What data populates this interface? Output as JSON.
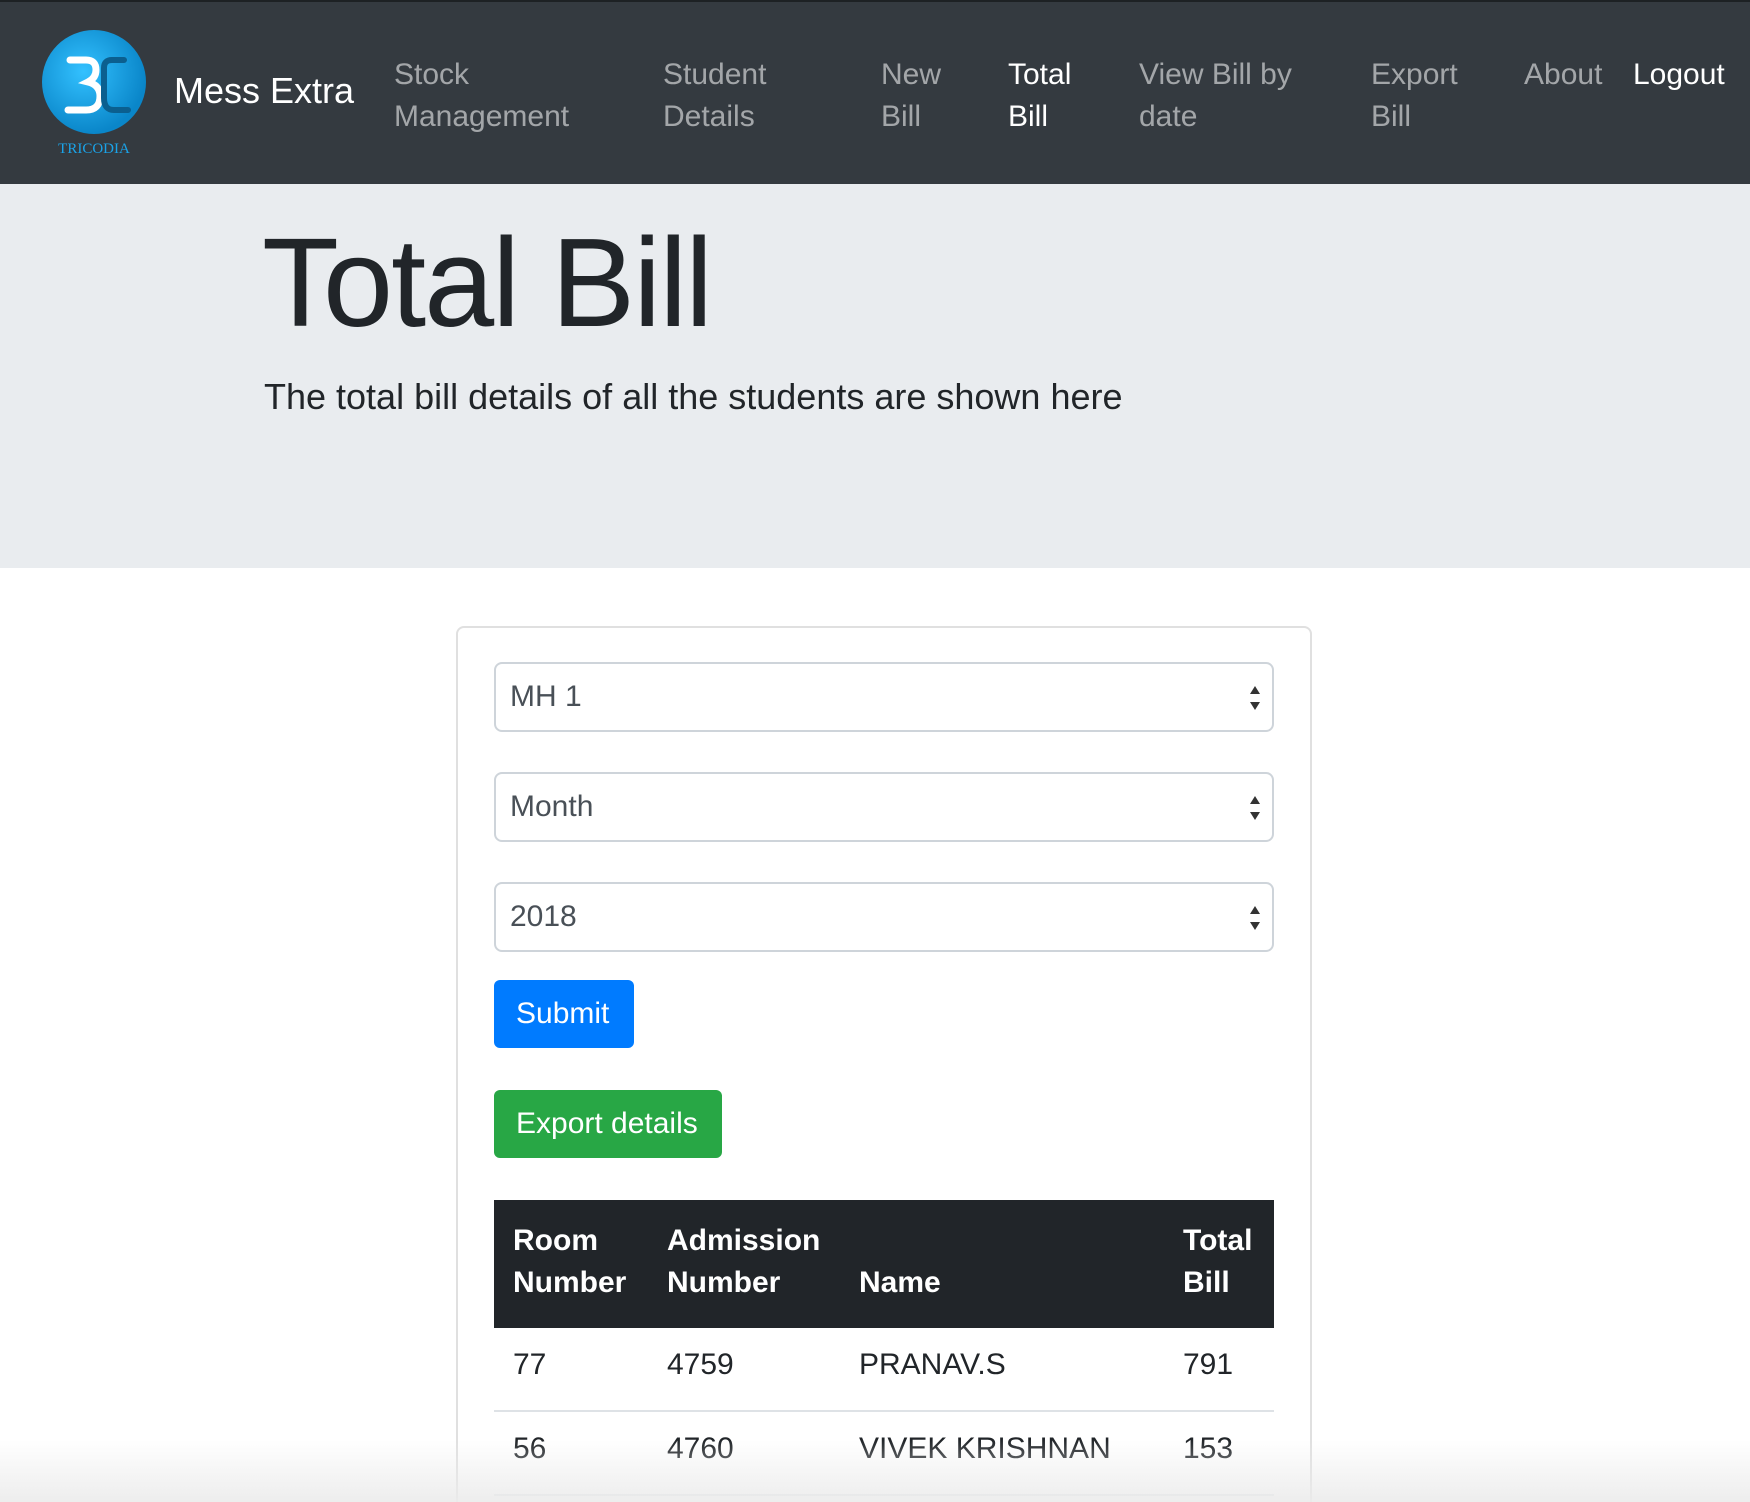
{
  "brand": {
    "logo_text": "TRICODIA",
    "name": "Mess Extra"
  },
  "nav": {
    "items": [
      {
        "label": "Stock Management"
      },
      {
        "label": "Student Details"
      },
      {
        "label": "New Bill"
      },
      {
        "label": "Total Bill",
        "active": true
      },
      {
        "label": "View Bill by date"
      },
      {
        "label": "Export Bill"
      },
      {
        "label": "About"
      }
    ],
    "logout_label": "Logout"
  },
  "jumbotron": {
    "title": "Total Bill",
    "lead": "The total bill details of all the students are shown here"
  },
  "form": {
    "hostel_select": "MH 1",
    "month_select": "Month",
    "year_select": "2018",
    "submit_label": "Submit",
    "export_label": "Export details"
  },
  "table": {
    "headers": [
      "Room Number",
      "Admission Number",
      "Name",
      "Total Bill"
    ],
    "rows": [
      [
        "77",
        "4759",
        "PRANAV.S",
        "791"
      ],
      [
        "56",
        "4760",
        "VIVEK KRISHNAN",
        "153"
      ]
    ]
  },
  "colors": {
    "navbar": "#343a40",
    "jumbotron": "#e9ecef",
    "primary": "#007bff",
    "success": "#28a745",
    "table_head": "#212529",
    "logo_blue": "#1aa3e8"
  }
}
